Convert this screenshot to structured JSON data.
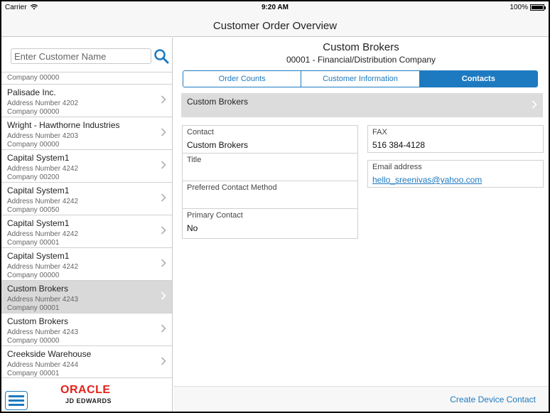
{
  "status_bar": {
    "carrier": "Carrier",
    "time": "9:20 AM",
    "battery": "100%"
  },
  "header": {
    "title": "Customer Order Overview"
  },
  "search": {
    "placeholder": "Enter Customer Name"
  },
  "customer_list": {
    "partial_top": "Company 00000",
    "items": [
      {
        "name": "Palisade Inc.",
        "address": "Address Number 4202",
        "company": "Company 00000",
        "selected": false
      },
      {
        "name": "Wright - Hawthorne Industries",
        "address": "Address Number 4203",
        "company": "Company 00000",
        "selected": false
      },
      {
        "name": "Capital System1",
        "address": "Address Number 4242",
        "company": "Company 00200",
        "selected": false
      },
      {
        "name": "Capital System1",
        "address": "Address Number 4242",
        "company": "Company 00050",
        "selected": false
      },
      {
        "name": "Capital System1",
        "address": "Address Number 4242",
        "company": "Company 00001",
        "selected": false
      },
      {
        "name": "Capital System1",
        "address": "Address Number 4242",
        "company": "Company 00000",
        "selected": false
      },
      {
        "name": "Custom Brokers",
        "address": "Address Number 4243",
        "company": "Company 00001",
        "selected": true
      },
      {
        "name": "Custom Brokers",
        "address": "Address Number 4243",
        "company": "Company 00000",
        "selected": false
      },
      {
        "name": "Creekside Warehouse",
        "address": "Address Number 4244",
        "company": "Company 00001",
        "selected": false
      }
    ]
  },
  "branding": {
    "oracle": "ORACLE",
    "jde": "JD EDWARDS"
  },
  "detail": {
    "customer_name": "Custom Brokers",
    "customer_sub": "00001 - Financial/Distribution Company",
    "tabs": [
      {
        "label": "Order Counts",
        "active": false
      },
      {
        "label": "Customer Information",
        "active": false
      },
      {
        "label": "Contacts",
        "active": true
      }
    ],
    "contact_header": "Custom Brokers",
    "left_fields": [
      {
        "label": "Contact",
        "value": "Custom Brokers"
      },
      {
        "label": "Title",
        "value": ""
      },
      {
        "label": "Preferred Contact Method",
        "value": ""
      },
      {
        "label": "Primary Contact",
        "value": "No"
      }
    ],
    "fax": {
      "label": "FAX",
      "value": "516 384-4128"
    },
    "email": {
      "label": "Email address",
      "value": "hello_sreenivas@yahoo.com"
    },
    "create_button": "Create Device Contact"
  },
  "colors": {
    "accent": "#1e7ac0",
    "selected_row": "#d9d9d9",
    "oracle_red": "#e2231a"
  }
}
